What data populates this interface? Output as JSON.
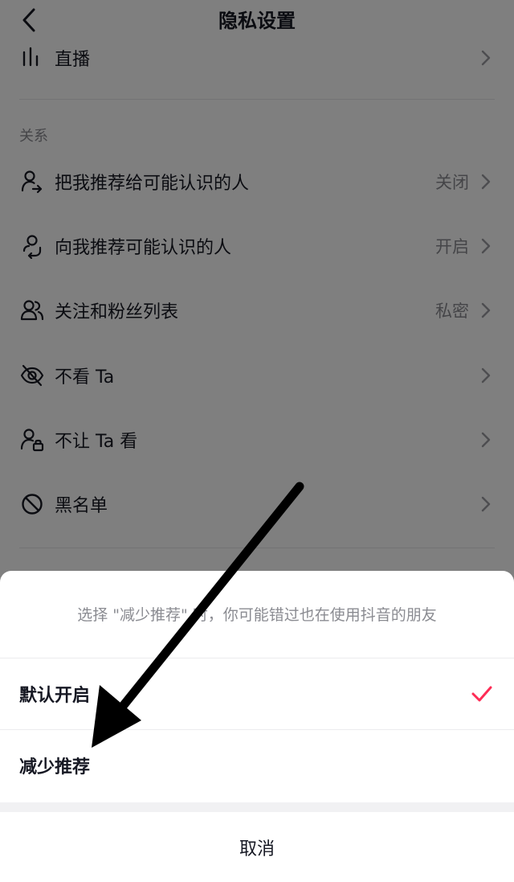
{
  "header": {
    "title": "隐私设置"
  },
  "top_item": {
    "label": "直播",
    "icon": "live-bars-icon"
  },
  "section": {
    "title": "关系"
  },
  "items": [
    {
      "label": "把我推荐给可能认识的人",
      "value": "关闭",
      "icon": "user-share-icon"
    },
    {
      "label": "向我推荐可能认识的人",
      "value": "开启",
      "icon": "user-recommend-icon"
    },
    {
      "label": "关注和粉丝列表",
      "value": "私密",
      "icon": "users-icon"
    },
    {
      "label": "不看 Ta",
      "value": "",
      "icon": "eye-off-icon"
    },
    {
      "label": "不让 Ta 看",
      "value": "",
      "icon": "user-lock-icon"
    },
    {
      "label": "黑名单",
      "value": "",
      "icon": "block-icon"
    }
  ],
  "sheet": {
    "hint": "选择 \"减少推荐\" 时，你可能错过也在使用抖音的朋友",
    "options": [
      {
        "label": "默认开启",
        "selected": true
      },
      {
        "label": "减少推荐",
        "selected": false
      }
    ],
    "cancel": "取消"
  },
  "colors": {
    "accent": "#fe2c55",
    "overlay": "rgba(0,0,0,0.50)"
  }
}
